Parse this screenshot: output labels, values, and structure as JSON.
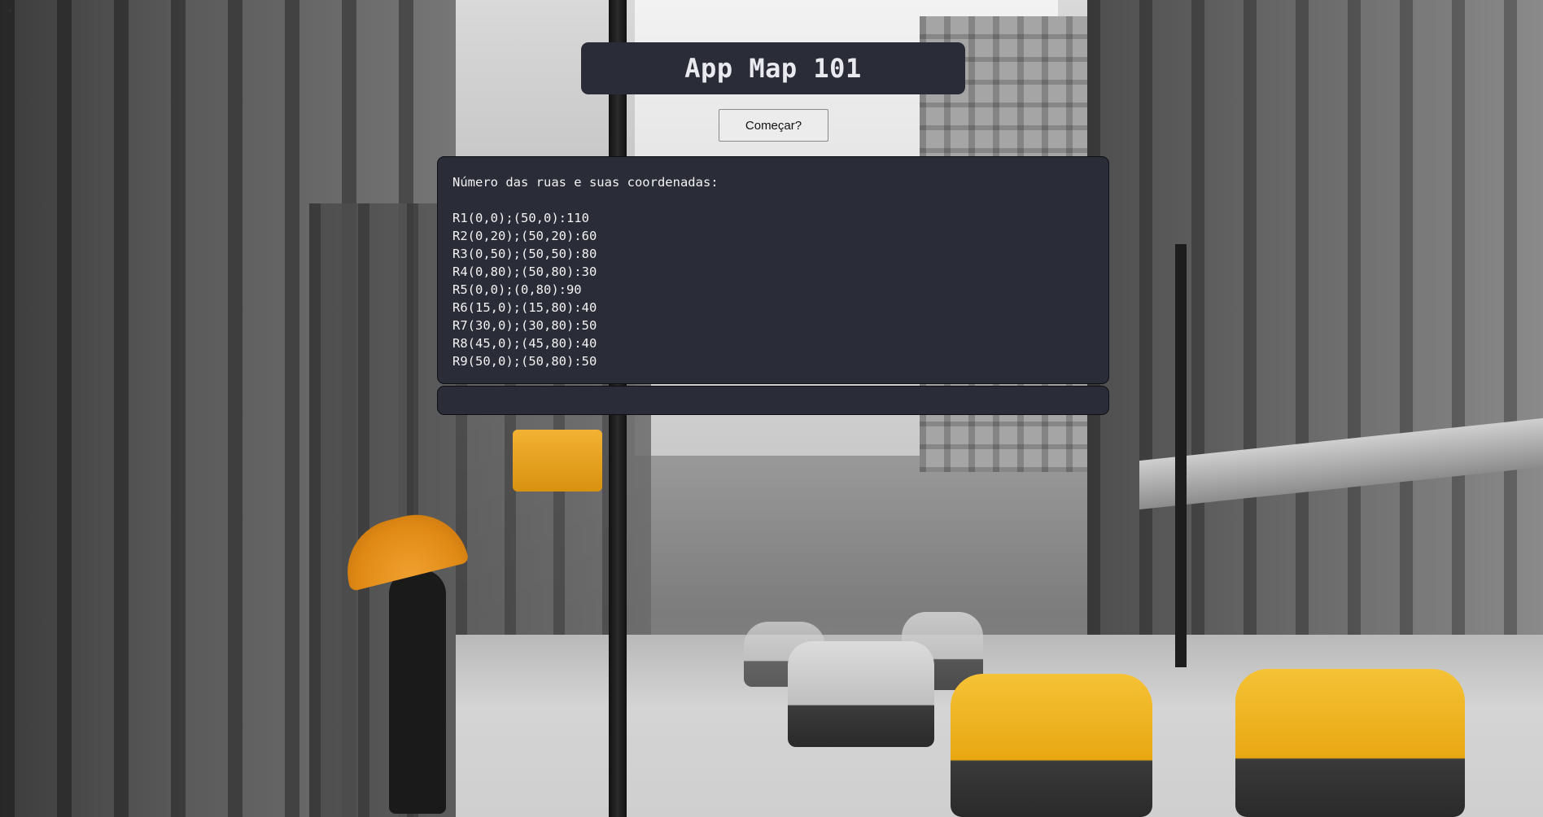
{
  "app": {
    "title": "App Map 101"
  },
  "controls": {
    "start_label": "Começar?"
  },
  "streets_panel": {
    "heading": "Número das ruas e suas coordenadas:",
    "streets": [
      "R1(0,0);(50,0):110",
      "R2(0,20);(50,20):60",
      "R3(0,50);(50,50):80",
      "R4(0,80);(50,80):30",
      "R5(0,0);(0,80):90",
      "R6(15,0);(15,80):40",
      "R7(30,0);(30,80):50",
      "R8(45,0);(45,80):40",
      "R9(50,0);(50,80):50"
    ]
  },
  "output_panel": {
    "text": ""
  },
  "theme": {
    "panel_bg": "#2a2d38",
    "panel_text": "#f2f2f2",
    "button_bg": "#ececec"
  }
}
